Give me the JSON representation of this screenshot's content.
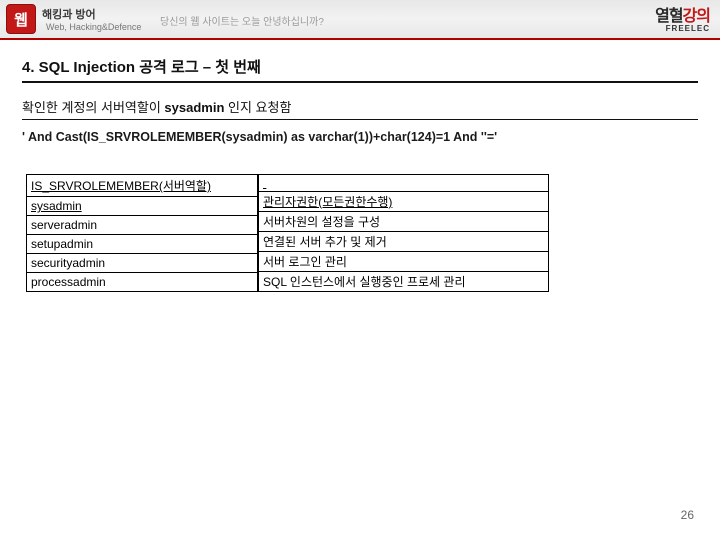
{
  "banner": {
    "badge": "웹",
    "logo_main": "해킹과 방어",
    "logo_sub": "Web, Hacking&Defence",
    "tagline": "당신의 웹 사이트는 오늘 안녕하십니까?",
    "brand_kr_1": "열혈",
    "brand_kr_2": "강의",
    "brand_en": "FREELEC"
  },
  "section": {
    "title": "4. SQL Injection 공격 로그 – 첫 번째",
    "desc_prefix": "확인한 계정의 서버역할이 ",
    "desc_bold": "sysadmin",
    "desc_suffix": " 인지 요청함",
    "code": "' And Cast(IS_SRVROLEMEMBER(sysadmin) as  varchar(1))+char(124)=1 And ''='"
  },
  "left_table": {
    "header": "IS_SRVROLEMEMBER(서버역할)",
    "rows": [
      "sysadmin",
      "serveradmin",
      "setupadmin",
      "securityadmin",
      "processadmin"
    ]
  },
  "right_table": {
    "header": "관리자권한(모든권한수행)",
    "rows": [
      "서버차원의 설정을 구성",
      "연결된 서버 추가 및 제거",
      "서버 로그인 관리",
      "SQL 인스턴스에서 실행중인 프로세 관리"
    ]
  },
  "page_number": "26"
}
